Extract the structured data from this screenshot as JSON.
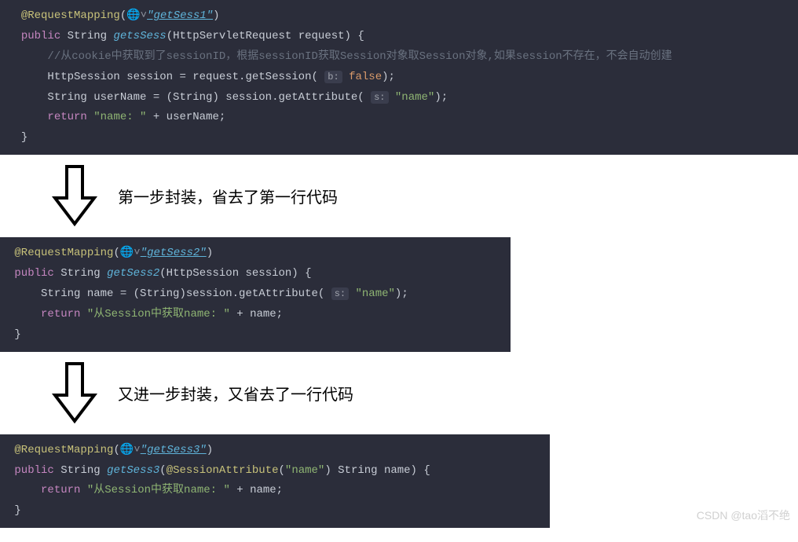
{
  "block1": {
    "annotation": "@RequestMapping",
    "mapping_value": "\"getSess1\"",
    "kw_public": "public",
    "ret_type": "String",
    "method_name": "getsSess",
    "params": "(HttpServletRequest request) {",
    "comment": "//从cookie中获取到了sessionID，根据sessionID获取Session对象取Session对象,如果session不存在，不会自动创建",
    "l3_a": "HttpSession session = request.getSession( ",
    "l3_hint": "b:",
    "l3_false": "false",
    "l3_end": ");",
    "l4_a": "String userName = (String) session.getAttribute( ",
    "l4_hint": "s:",
    "l4_str": "\"name\"",
    "l4_end": ");",
    "kw_return": "return",
    "ret_str": "\"name: \"",
    "ret_tail": " + userName;",
    "close": "}"
  },
  "arrow1_caption": "第一步封装，省去了第一行代码",
  "block2": {
    "annotation": "@RequestMapping",
    "mapping_value": "\"getSess2\"",
    "kw_public": "public",
    "ret_type": "String",
    "method_name": "getSess2",
    "params": "(HttpSession session) {",
    "l2_a": "String name = (String)session.getAttribute( ",
    "l2_hint": "s:",
    "l2_str": "\"name\"",
    "l2_end": ");",
    "kw_return": "return",
    "ret_str": "\"从Session中获取name: \"",
    "ret_tail": " + name;",
    "close": "}"
  },
  "arrow2_caption": "又进一步封装，又省去了一行代码",
  "block3": {
    "annotation": "@RequestMapping",
    "mapping_value": "\"getSess3\"",
    "kw_public": "public",
    "ret_type": "String",
    "method_name": "getSess3",
    "params_a": "(",
    "sess_attr": "@SessionAttribute",
    "params_b": "(",
    "attr_str": "\"name\"",
    "params_c": ") String name) {",
    "kw_return": "return",
    "ret_str": "\"从Session中获取name: \"",
    "ret_tail": " + name;",
    "close": "}"
  },
  "watermark": "CSDN @tao滔不绝"
}
